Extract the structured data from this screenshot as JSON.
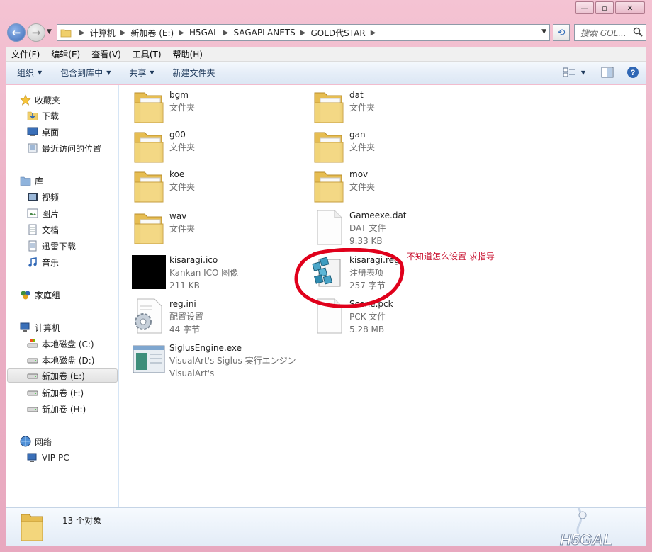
{
  "window": {
    "controls": {
      "minimize": "—",
      "maximize": "▫",
      "close": "✕"
    }
  },
  "address": {
    "crumbs": [
      "计算机",
      "新加卷 (E:)",
      "H5GAL",
      "SAGAPLANETS",
      "GOLD代STAR"
    ],
    "search_placeholder": "搜索 GOL..."
  },
  "menubar": [
    "文件(F)",
    "编辑(E)",
    "查看(V)",
    "工具(T)",
    "帮助(H)"
  ],
  "cmdbar": {
    "organize": "组织",
    "include_library": "包含到库中",
    "share": "共享",
    "new_folder": "新建文件夹"
  },
  "navpane": {
    "favorites": {
      "label": "收藏夹",
      "items": [
        "下载",
        "桌面",
        "最近访问的位置"
      ]
    },
    "libraries": {
      "label": "库",
      "items": [
        "视频",
        "图片",
        "文档",
        "迅雷下载",
        "音乐"
      ]
    },
    "homegroup": "家庭组",
    "computer": {
      "label": "计算机",
      "items": [
        "本地磁盘 (C:)",
        "本地磁盘 (D:)",
        "新加卷 (E:)",
        "新加卷 (F:)",
        "新加卷 (H:)"
      ]
    },
    "network": {
      "label": "网络",
      "items": [
        "VIP-PC"
      ]
    }
  },
  "files": [
    {
      "name": "bgm",
      "type": "文件夹",
      "size": "",
      "icon": "folder-icon"
    },
    {
      "name": "dat",
      "type": "文件夹",
      "size": "",
      "icon": "folder-icon"
    },
    {
      "name": "g00",
      "type": "文件夹",
      "size": "",
      "icon": "folder-icon"
    },
    {
      "name": "gan",
      "type": "文件夹",
      "size": "",
      "icon": "folder-icon"
    },
    {
      "name": "koe",
      "type": "文件夹",
      "size": "",
      "icon": "folder-icon"
    },
    {
      "name": "mov",
      "type": "文件夹",
      "size": "",
      "icon": "folder-icon"
    },
    {
      "name": "wav",
      "type": "文件夹",
      "size": "",
      "icon": "folder-icon"
    },
    {
      "name": "Gameexe.dat",
      "type": "DAT 文件",
      "size": "9.33 KB",
      "icon": "document-icon"
    },
    {
      "name": "kisaragi.ico",
      "type": "Kankan ICO 图像",
      "size": "211 KB",
      "icon": "ico-thumbnail"
    },
    {
      "name": "kisaragi.reg",
      "type": "注册表项",
      "size": "257 字节",
      "icon": "registry-icon"
    },
    {
      "name": "reg.ini",
      "type": "配置设置",
      "size": "44 字节",
      "icon": "settings-file-icon"
    },
    {
      "name": "Scene.pck",
      "type": "PCK 文件",
      "size": "5.28 MB",
      "icon": "document-icon"
    },
    {
      "name": "SiglusEngine.exe",
      "type": "VisualArt's Siglus 実行エンジン",
      "size": "VisualArt's",
      "icon": "application-icon"
    }
  ],
  "annotation": {
    "note": "不知道怎么设置  求指导",
    "color": "#d0001c"
  },
  "details": {
    "count": "13 个对象"
  },
  "colors": {
    "frame": "#ecb1c6",
    "folder": "#f0cf6b",
    "link": "#1e395b"
  }
}
